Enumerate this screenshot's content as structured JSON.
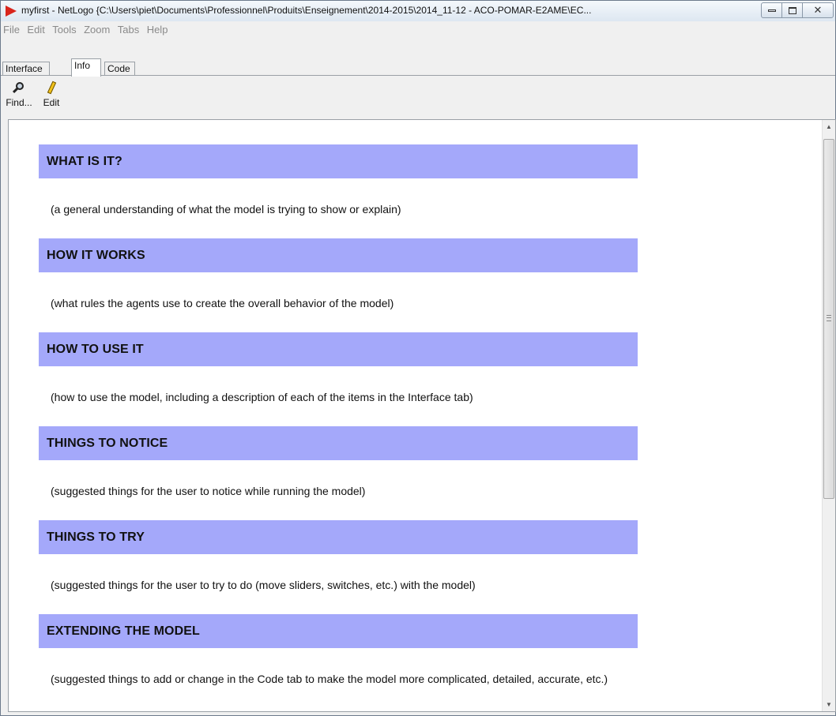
{
  "window": {
    "title": "myfirst - NetLogo {C:\\Users\\piet\\Documents\\Professionnel\\Produits\\Enseignement\\2014-2015\\2014_11-12 - ACO-POMAR-E2AME\\EC...",
    "controls": {
      "minimize_icon": "minimize-icon",
      "maximize_icon": "maximize-icon",
      "close_icon": "close-icon",
      "close_glyph": "✕"
    }
  },
  "menubar": {
    "items": [
      "File",
      "Edit",
      "Tools",
      "Zoom",
      "Tabs",
      "Help"
    ]
  },
  "tabs": {
    "items": [
      "Interface",
      "Info",
      "Code"
    ],
    "active": "Info"
  },
  "toolbar": {
    "find_label": "Find...",
    "edit_label": "Edit",
    "find_icon": "magnifier-icon",
    "edit_icon": "pencil-icon"
  },
  "info": {
    "sections": [
      {
        "heading": "WHAT IS IT?",
        "body": "(a general understanding of what the model is trying to show or explain)"
      },
      {
        "heading": "HOW IT WORKS",
        "body": "(what rules the agents use to create the overall behavior of the model)"
      },
      {
        "heading": "HOW TO USE IT",
        "body": "(how to use the model, including a description of each of the items in the Interface tab)"
      },
      {
        "heading": "THINGS TO NOTICE",
        "body": "(suggested things for the user to notice while running the model)"
      },
      {
        "heading": "THINGS TO TRY",
        "body": "(suggested things for the user to try to do (move sliders, switches, etc.) with the model)"
      },
      {
        "heading": "EXTENDING THE MODEL",
        "body": "(suggested things to add or change in the Code tab to make the model more complicated, detailed, accurate, etc.)"
      }
    ]
  },
  "scrollbar": {
    "up_glyph": "▲",
    "down_glyph": "▼"
  },
  "colors": {
    "section_header_bg": "#a4a8fa",
    "app_icon": "#d9251c"
  }
}
